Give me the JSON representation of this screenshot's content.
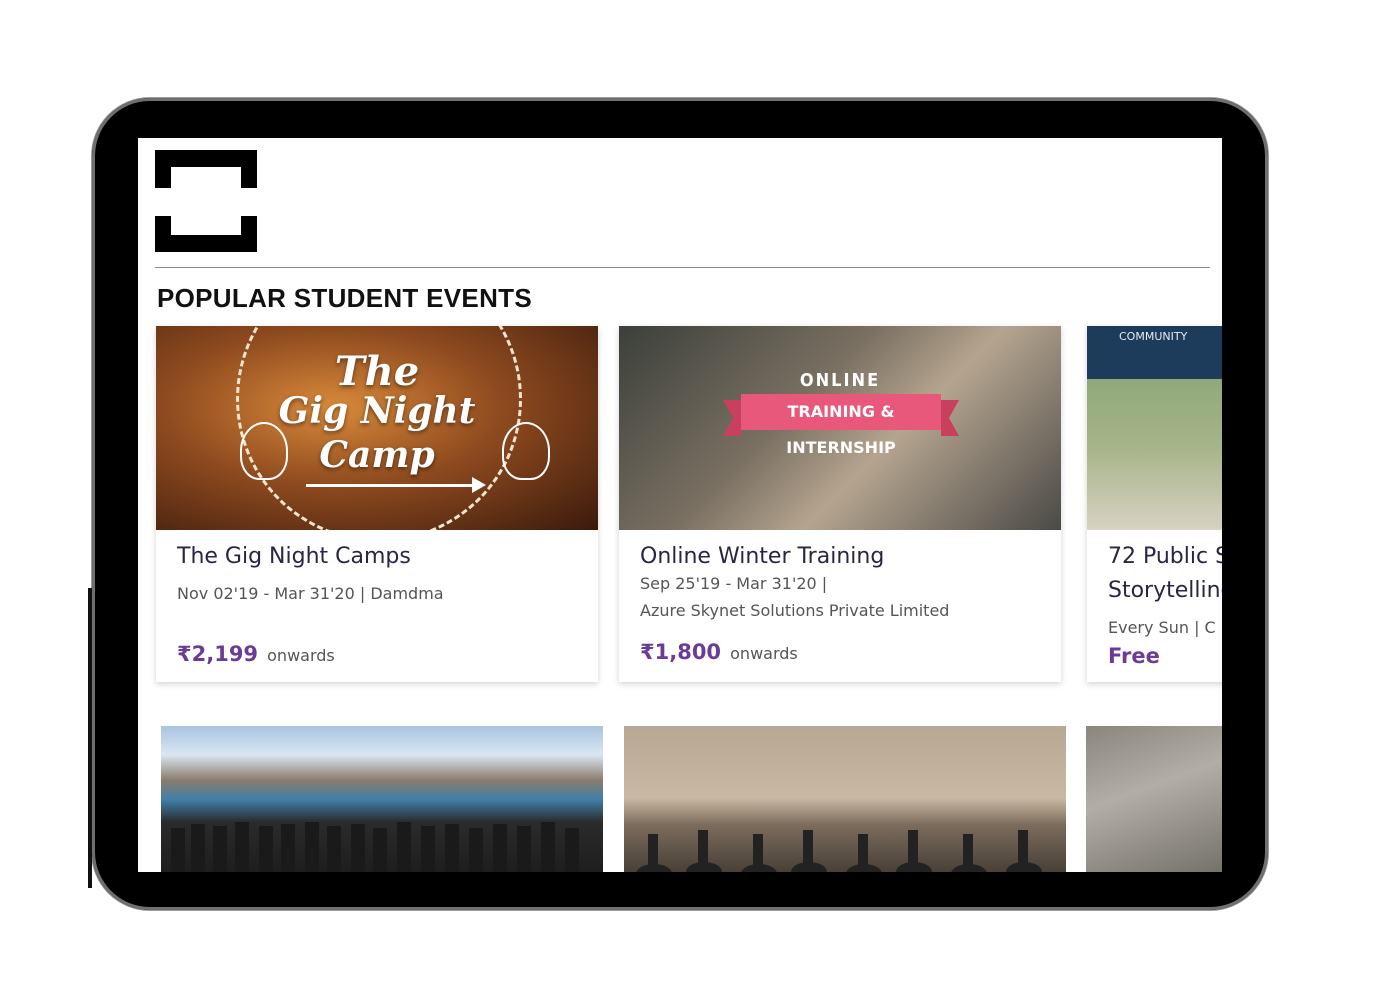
{
  "section": {
    "title": "POPULAR STUDENT EVENTS"
  },
  "events": [
    {
      "image_text": {
        "line1": "The",
        "line2": "Gig Night",
        "line3": "Camp"
      },
      "title": "The Gig Night Camps",
      "meta_line1": "Nov 02'19 - Mar 31'20  |  Damdma",
      "meta_line2": "",
      "price": "₹2,199",
      "price_suffix": "onwards"
    },
    {
      "image_text": {
        "line1": "ONLINE",
        "line2": "TRAINING & INTERNSHIP"
      },
      "title": "Online Winter Training",
      "meta_line1": "Sep 25'19 - Mar 31'20  |",
      "meta_line2": "Azure Skynet Solutions Private Limited",
      "price": "₹1,800",
      "price_suffix": "onwards"
    },
    {
      "image_text": {
        "line1": "COMMUNITY"
      },
      "title": "72 Public S",
      "title_line2": "Storytelling",
      "meta_line1": "Every Sun  |  C",
      "meta_line2": "",
      "price": "Free",
      "price_suffix": ""
    }
  ],
  "colors": {
    "price": "#6a3c98",
    "title": "#2a2540",
    "frame": "#000000"
  }
}
